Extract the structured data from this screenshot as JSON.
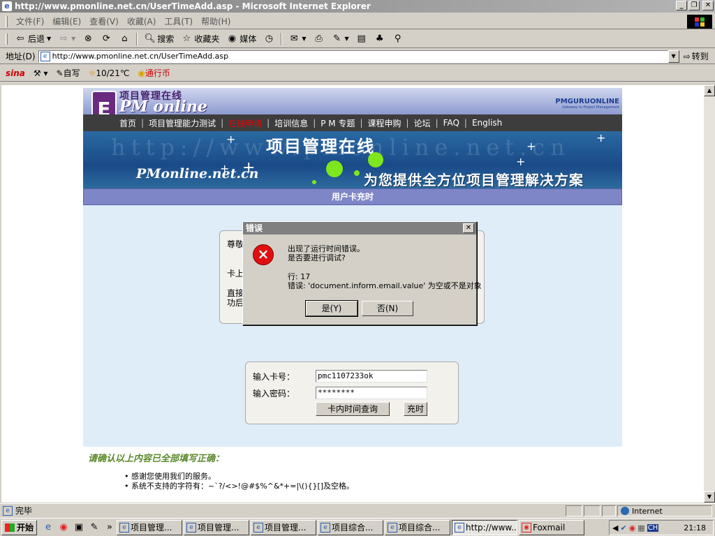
{
  "window": {
    "title": "http://www.pmonline.net.cn/UserTimeAdd.asp - Microsoft Internet Explorer",
    "minimize": "_",
    "restore": "❐",
    "close": "✕"
  },
  "menu": [
    "文件(F)",
    "编辑(E)",
    "查看(V)",
    "收藏(A)",
    "工具(T)",
    "帮助(H)"
  ],
  "toolbar": {
    "back": "后退",
    "search": "搜索",
    "favorites": "收藏夹",
    "media": "媒体"
  },
  "address": {
    "label": "地址(D)",
    "url": "http://www.pmonline.net.cn/UserTimeAdd.asp",
    "go": "转到"
  },
  "links": {
    "sina": "sina",
    "write": "自写",
    "weather": "10/21℃",
    "coin": "通行币"
  },
  "site": {
    "logo_cn": "项目管理在线",
    "logo_en": "PM online",
    "partner": "PMGURUONLINE",
    "partner_sub": "Gateway to Project Management",
    "nav": [
      "首页",
      "项目管理能力测试",
      "在线申请",
      "培训信息",
      "P M 专题",
      "课程申购",
      "论坛",
      "FAQ",
      "English"
    ],
    "banner_watermark": "http://www.pmonline.net.cn",
    "banner_title": "项目管理在线",
    "banner_site": "PMonline.net.cn",
    "banner_slogan": "为您提供全方位项目管理解决方案",
    "page_title": "用户卡充时"
  },
  "info_box": {
    "line1": "尊敬",
    "line2": "卡上",
    "line3": "直接",
    "line4": "功后"
  },
  "form": {
    "card_label": "输入卡号：",
    "card_value": "pmc1107233ok",
    "password_label": "输入密码：",
    "password_value": "********",
    "query_button": "卡内时间查询",
    "recharge_button": "充时"
  },
  "confirm_text": "请确认以上内容已全部填写正确：",
  "notes": [
    "• 感谢您使用我们的服务。",
    "• 系统不支持的字符有：~`?/<>!@#$%^&*+=|\\(){}[]及空格。"
  ],
  "dialog": {
    "title": "错误",
    "close": "✕",
    "icon": "×",
    "message1": "出现了运行时间错误。",
    "message2": "是否要进行调试?",
    "line": "行: 17",
    "error": "错误: 'document.inform.email.value' 为空或不是对象",
    "yes": "是(Y)",
    "no": "否(N)"
  },
  "status": {
    "text": "完毕",
    "zone": "Internet"
  },
  "taskbar": {
    "start": "开始",
    "more": "»",
    "tasks": [
      "项目管理...",
      "项目管理...",
      "项目管理...",
      "项目综合...",
      "项目综合...",
      "http://www...",
      "Foxmail"
    ],
    "ime": "CH",
    "clock": "21:18"
  },
  "colors": {
    "error_red": "#e01010",
    "nav_highlight": "#e00000",
    "confirm_green": "#5b8a2b",
    "page_bar": "#7f86c8"
  }
}
